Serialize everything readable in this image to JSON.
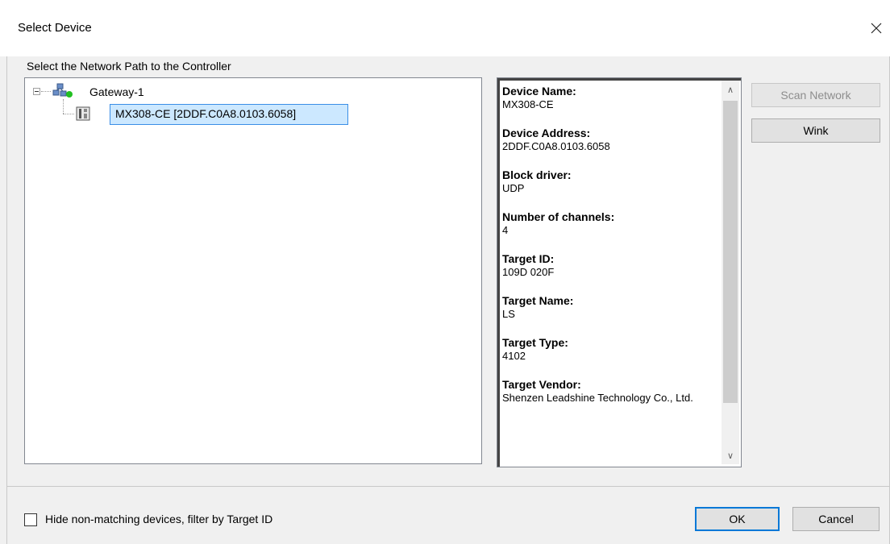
{
  "window": {
    "title": "Select Device"
  },
  "tree": {
    "label": "Select the Network Path to the Controller",
    "gateway": {
      "label": "Gateway-1"
    },
    "device": {
      "label": "MX308-CE [2DDF.C0A8.0103.6058]"
    }
  },
  "info": {
    "fields": [
      {
        "label": "Device Name:",
        "value": "MX308-CE"
      },
      {
        "label": "Device Address:",
        "value": "2DDF.C0A8.0103.6058"
      },
      {
        "label": "Block driver:",
        "value": "UDP"
      },
      {
        "label": "Number of channels:",
        "value": "4"
      },
      {
        "label": "Target ID:",
        "value": "109D 020F"
      },
      {
        "label": "Target Name:",
        "value": "LS"
      },
      {
        "label": "Target Type:",
        "value": "4102"
      },
      {
        "label": "Target Vendor:",
        "value": "Shenzen Leadshine Technology Co., Ltd."
      }
    ]
  },
  "buttons": {
    "scan": "Scan Network",
    "wink": "Wink",
    "ok": "OK",
    "cancel": "Cancel"
  },
  "filter": {
    "label": "Hide non-matching devices, filter by Target ID"
  },
  "colors": {
    "selection": "#cce8ff",
    "selection_border": "#3a8ee6",
    "status_green": "#22c022"
  }
}
